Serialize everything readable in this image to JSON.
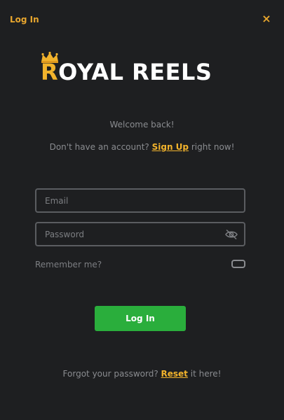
{
  "header": {
    "title": "Log In",
    "close_symbol": "×"
  },
  "logo": {
    "first_letter": "R",
    "rest": "OYAL REELS",
    "icon": "crown-icon"
  },
  "welcome": "Welcome back!",
  "signup": {
    "prefix": "Don't have an account? ",
    "link": "Sign Up",
    "suffix": " right now!"
  },
  "form": {
    "email_placeholder": "Email",
    "password_placeholder": "Password",
    "password_toggle_icon": "eye-slash-icon",
    "remember_label": "Remember me?",
    "submit_label": "Log In"
  },
  "forgot": {
    "prefix": "Forgot your password? ",
    "link": "Reset",
    "suffix": " it here!"
  },
  "colors": {
    "background": "#1e1f21",
    "accent": "#f2b32c",
    "button": "#2aae3c"
  }
}
